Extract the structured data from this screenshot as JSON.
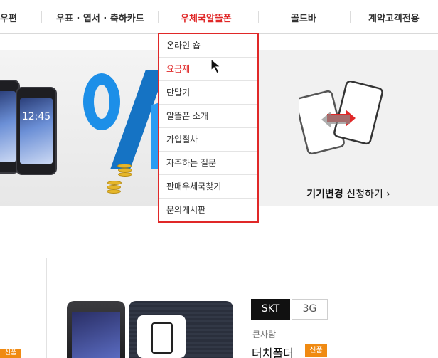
{
  "nav": {
    "items": [
      {
        "label": "우편"
      },
      {
        "label": "우표 · 엽서 · 축하카드"
      },
      {
        "label": "우체국알뜰폰"
      },
      {
        "label": "골드바"
      },
      {
        "label": "계약고객전용"
      }
    ],
    "active_index": 2
  },
  "dropdown": {
    "items": [
      {
        "label": "온라인 숍"
      },
      {
        "label": "요금제"
      },
      {
        "label": "단말기"
      },
      {
        "label": "알뜰폰 소개"
      },
      {
        "label": "가입절차"
      },
      {
        "label": "자주하는 질문"
      },
      {
        "label": "판매우체국찾기"
      },
      {
        "label": "문의게시판"
      }
    ],
    "highlighted_index": 1
  },
  "banner": {
    "phone_clock": "12:45",
    "device_change_bold": "기기변경",
    "device_change_rest": " 신청하기",
    "device_change_arrow": "›"
  },
  "product": {
    "carrier_tabs": [
      "SKT",
      "3G"
    ],
    "maker": "큰사람",
    "model": "터치폴더",
    "badge_new": "신품",
    "left_badge": "신품"
  },
  "colors": {
    "accent": "#e02828",
    "badge": "#f08a12"
  },
  "icons": [
    "cursor-arrow-icon",
    "device-change-icon",
    "chevron-right-icon",
    "percent-graphic",
    "smartphone-image",
    "flip-phone-image"
  ]
}
